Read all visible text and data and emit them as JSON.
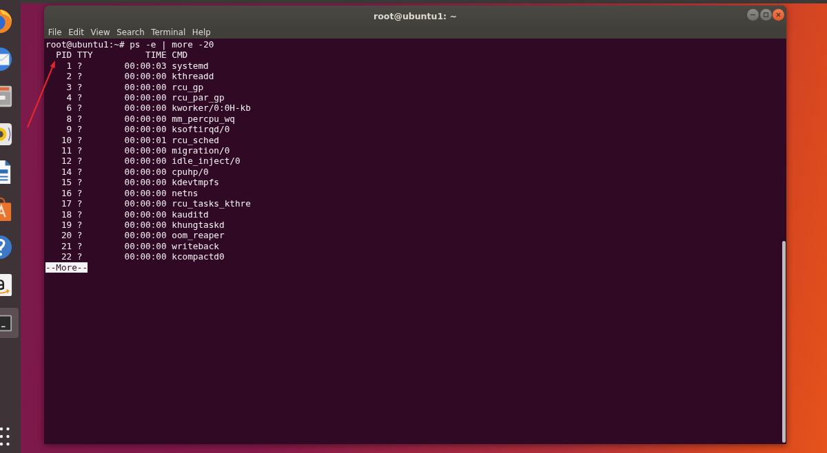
{
  "dock": {
    "items": [
      {
        "kind": "browser",
        "active": false
      },
      {
        "kind": "mail",
        "active": false
      },
      {
        "kind": "files",
        "active": false
      },
      {
        "kind": "music",
        "active": false
      },
      {
        "kind": "document",
        "active": false
      },
      {
        "kind": "store",
        "active": false
      },
      {
        "kind": "help",
        "active": false
      },
      {
        "kind": "shop",
        "active": false
      },
      {
        "kind": "terminal",
        "active": true
      }
    ]
  },
  "window": {
    "title": "root@ubuntu1: ~"
  },
  "menu": [
    "File",
    "Edit",
    "View",
    "Search",
    "Terminal",
    "Help"
  ],
  "terminal": {
    "command_line": "root@ubuntu1:~# ps -e | more -20",
    "process_table": {
      "columns": [
        "PID",
        "TTY",
        "TIME",
        "CMD"
      ],
      "rows": [
        {
          "pid": "1",
          "tty": "?",
          "time": "00:00:03",
          "cmd": "systemd"
        },
        {
          "pid": "2",
          "tty": "?",
          "time": "00:00:00",
          "cmd": "kthreadd"
        },
        {
          "pid": "3",
          "tty": "?",
          "time": "00:00:00",
          "cmd": "rcu_gp"
        },
        {
          "pid": "4",
          "tty": "?",
          "time": "00:00:00",
          "cmd": "rcu_par_gp"
        },
        {
          "pid": "6",
          "tty": "?",
          "time": "00:00:00",
          "cmd": "kworker/0:0H-kb"
        },
        {
          "pid": "8",
          "tty": "?",
          "time": "00:00:00",
          "cmd": "mm_percpu_wq"
        },
        {
          "pid": "9",
          "tty": "?",
          "time": "00:00:00",
          "cmd": "ksoftirqd/0"
        },
        {
          "pid": "10",
          "tty": "?",
          "time": "00:00:01",
          "cmd": "rcu_sched"
        },
        {
          "pid": "11",
          "tty": "?",
          "time": "00:00:00",
          "cmd": "migration/0"
        },
        {
          "pid": "12",
          "tty": "?",
          "time": "00:00:00",
          "cmd": "idle_inject/0"
        },
        {
          "pid": "14",
          "tty": "?",
          "time": "00:00:00",
          "cmd": "cpuhp/0"
        },
        {
          "pid": "15",
          "tty": "?",
          "time": "00:00:00",
          "cmd": "kdevtmpfs"
        },
        {
          "pid": "16",
          "tty": "?",
          "time": "00:00:00",
          "cmd": "netns"
        },
        {
          "pid": "17",
          "tty": "?",
          "time": "00:00:00",
          "cmd": "rcu_tasks_kthre"
        },
        {
          "pid": "18",
          "tty": "?",
          "time": "00:00:00",
          "cmd": "kauditd"
        },
        {
          "pid": "19",
          "tty": "?",
          "time": "00:00:00",
          "cmd": "khungtaskd"
        },
        {
          "pid": "20",
          "tty": "?",
          "time": "00:00:00",
          "cmd": "oom_reaper"
        },
        {
          "pid": "21",
          "tty": "?",
          "time": "00:00:00",
          "cmd": "writeback"
        },
        {
          "pid": "22",
          "tty": "?",
          "time": "00:00:00",
          "cmd": "kcompactd0"
        }
      ]
    },
    "pager_prompt": "--More--"
  }
}
